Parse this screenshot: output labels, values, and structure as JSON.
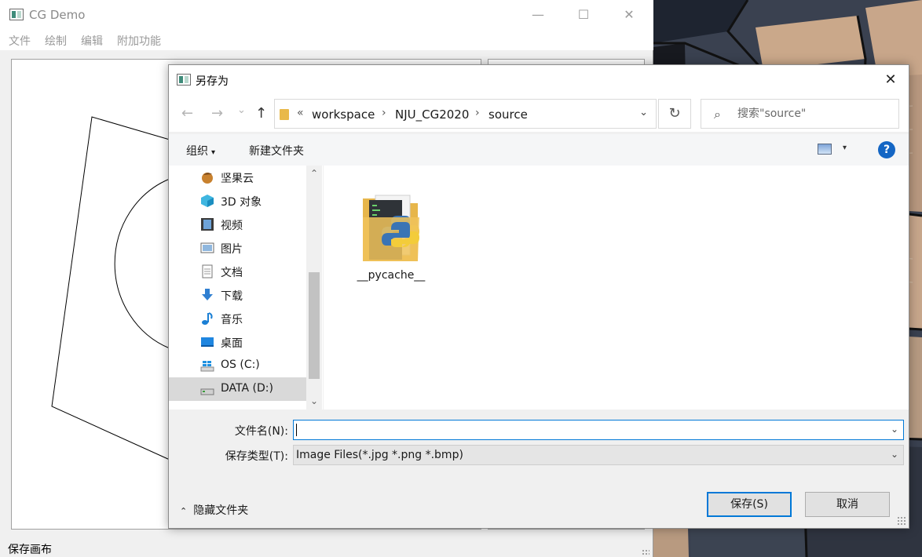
{
  "main_window": {
    "title": "CG Demo",
    "controls": {
      "minimize": "—",
      "maximize": "☐",
      "close": "✕"
    },
    "menu": [
      "文件",
      "绘制",
      "编辑",
      "附加功能"
    ],
    "status_text": "保存画布"
  },
  "dialog": {
    "title": "另存为",
    "close": "✕",
    "nav": {
      "back": "←",
      "forward": "→",
      "recent": "⌄",
      "up": "↑"
    },
    "address": {
      "overflow": "«",
      "separator": "›",
      "segments": [
        "workspace",
        "NJU_CG2020",
        "source"
      ],
      "dropdown": "⌄"
    },
    "refresh": "↻",
    "search": {
      "icon": "⌕",
      "placeholder": "搜索\"source\""
    },
    "commands": {
      "organize": "组织",
      "organize_caret": "▾",
      "new_folder": "新建文件夹",
      "view_caret": "▾",
      "help": "?"
    },
    "nav_items": [
      {
        "label": "坚果云",
        "icon": "jianguoyun-icon"
      },
      {
        "label": "3D 对象",
        "icon": "3d-objects-icon"
      },
      {
        "label": "视频",
        "icon": "videos-icon"
      },
      {
        "label": "图片",
        "icon": "pictures-icon"
      },
      {
        "label": "文档",
        "icon": "documents-icon"
      },
      {
        "label": "下载",
        "icon": "downloads-icon"
      },
      {
        "label": "音乐",
        "icon": "music-icon"
      },
      {
        "label": "桌面",
        "icon": "desktop-icon"
      },
      {
        "label": "OS (C:)",
        "icon": "windows-drive-icon"
      },
      {
        "label": "DATA (D:)",
        "icon": "drive-icon",
        "selected": true
      }
    ],
    "scroll": {
      "up": "⌃",
      "down": "⌄"
    },
    "files": [
      {
        "name": "__pycache__",
        "icon": "python-folder-icon"
      }
    ],
    "filename": {
      "label": "文件名(N):",
      "value": "",
      "dropdown": "⌄"
    },
    "filetype": {
      "label": "保存类型(T):",
      "value": "Image Files(*.jpg *.png *.bmp)",
      "dropdown": "⌄"
    },
    "hide_folders": {
      "chevron": "⌃",
      "label": "隐藏文件夹"
    },
    "buttons": {
      "save": "保存(S)",
      "cancel": "取消"
    },
    "colors": {
      "accent": "#0078d7",
      "folder": "#e9b949",
      "help": "#1466c4"
    }
  }
}
